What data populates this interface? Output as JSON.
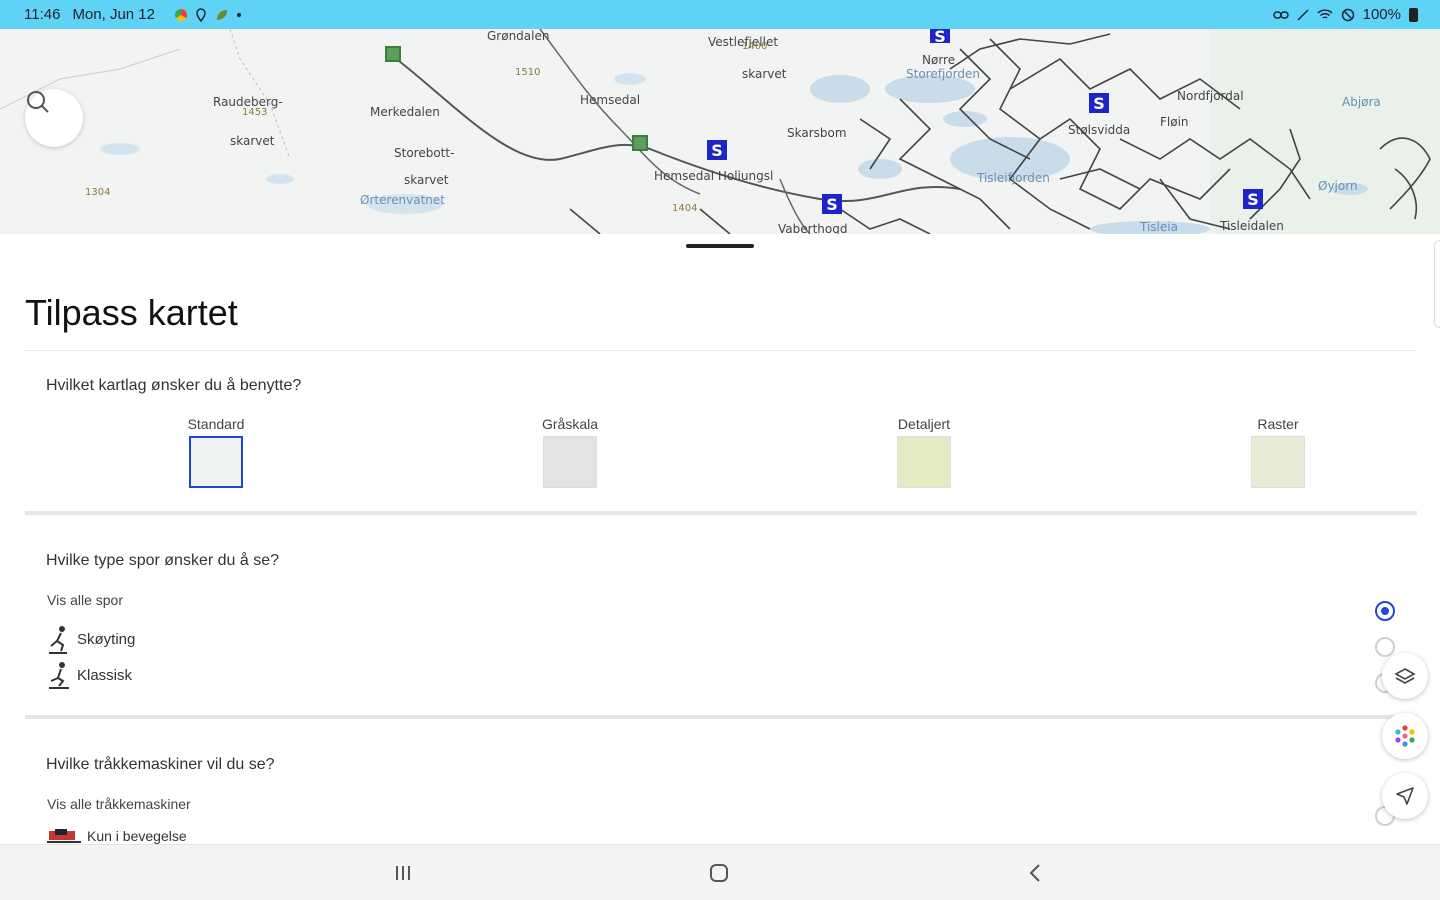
{
  "status_bar": {
    "time": "11:46",
    "date": "Mon, Jun 12",
    "battery": "100%",
    "icons": [
      "chrome-icon",
      "location-icon",
      "leaf-app-icon",
      "dot-icon",
      "link-icon",
      "wifi-icon",
      "dnd-icon",
      "battery-icon"
    ]
  },
  "map": {
    "labels": [
      {
        "text": "Grøndalen",
        "cls": ""
      },
      {
        "text": "Vestlefjellet",
        "cls": ""
      },
      {
        "text": "skarvet",
        "cls": ""
      },
      {
        "text": "Raudeberg-",
        "cls": ""
      },
      {
        "text": "skarvet",
        "cls": ""
      },
      {
        "text": "Merkedalen",
        "cls": ""
      },
      {
        "text": "Hemsedal",
        "cls": ""
      },
      {
        "text": "Storebott-",
        "cls": ""
      },
      {
        "text": "skarvet",
        "cls": ""
      },
      {
        "text": "Ørterenvatnet",
        "cls": "water"
      },
      {
        "text": "Hemsedal Holiungsl",
        "cls": ""
      },
      {
        "text": "Skarsbom",
        "cls": ""
      },
      {
        "text": "Nørre",
        "cls": ""
      },
      {
        "text": "Storefjorden",
        "cls": "water"
      },
      {
        "text": "Stølsvidda",
        "cls": ""
      },
      {
        "text": "Nordfjordal",
        "cls": ""
      },
      {
        "text": "Fløin",
        "cls": ""
      },
      {
        "text": "Tisleifjorden",
        "cls": "water"
      },
      {
        "text": "Tisleia",
        "cls": "water"
      },
      {
        "text": "Tisleidalen",
        "cls": ""
      },
      {
        "text": "Vaberthogd",
        "cls": ""
      },
      {
        "text": "Abjøra",
        "cls": "water"
      },
      {
        "text": "Øyjorn",
        "cls": "water"
      },
      {
        "text": "1304",
        "cls": "small"
      },
      {
        "text": "1400",
        "cls": "small"
      },
      {
        "text": "1404",
        "cls": "small"
      },
      {
        "text": "1453",
        "cls": "small"
      },
      {
        "text": "1510",
        "cls": "small"
      }
    ],
    "marker_letter": "S"
  },
  "sheet": {
    "title": "Tilpass kartet",
    "layer_question": "Hvilket kartlag ønsker du å benytte?",
    "layers": [
      {
        "label": "Standard",
        "selected": true,
        "color": "#eef2f3"
      },
      {
        "label": "Gråskala",
        "selected": false,
        "color": "#e3e3e3"
      },
      {
        "label": "Detaljert",
        "selected": false,
        "color": "#e3ebc3"
      },
      {
        "label": "Raster",
        "selected": false,
        "color": "#e8ecd6"
      }
    ],
    "trail_question": "Hvilke type spor ønsker du å se?",
    "trail_options": [
      {
        "label": "Vis alle spor",
        "icon": null,
        "selected": true
      },
      {
        "label": "Skøyting",
        "icon": "skating-skier-icon",
        "selected": false
      },
      {
        "label": "Klassisk",
        "icon": "classic-skier-icon",
        "selected": false
      }
    ],
    "groomer_question": "Hvilke tråkkemaskiner vil du se?",
    "groomer_options": [
      {
        "label": "Vis alle tråkkemaskiner",
        "selected": false
      },
      {
        "label": "Kun i bevegelse",
        "selected": false
      }
    ]
  },
  "fabs": [
    "layers-icon",
    "palette-icon",
    "navigate-icon"
  ],
  "accent_color": "#2146e0",
  "status_bar_color": "#5fd3f5"
}
